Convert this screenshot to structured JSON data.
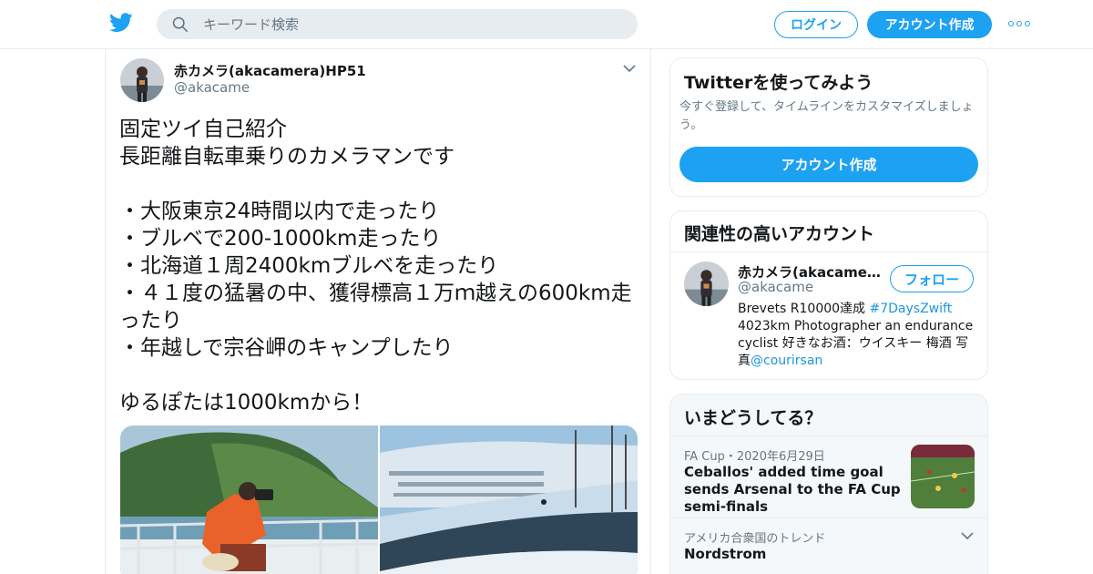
{
  "nav": {
    "search_placeholder": "キーワード検索",
    "login_label": "ログイン",
    "signup_label": "アカウント作成",
    "more_icon": "more-dots-icon",
    "brand_color": "#1da1f2"
  },
  "tweet": {
    "author_name": "赤カメラ(akacamera)HP51",
    "author_handle": "@akacame",
    "text": "固定ツイ自己紹介\n長距離自転車乗りのカメラマンです\n\n・大阪東京24時間以内で走ったり\n・ブルベで200-1000km走ったり\n・北海道１周2400kmブルベを走ったり\n・４１度の猛暑の中、獲得標高１万ｍ越えの600km走ったり\n・年越しで宗谷岬のキャンプしたり\n\nゆるぽたは1000kmから！",
    "media": [
      {
        "description_icon": "photo-cyclist-coast"
      },
      {
        "description_icon": "photo-snowy-road"
      }
    ]
  },
  "signup_card": {
    "title": "Twitterを使ってみよう",
    "subtitle": "今すぐ登録して、タイムラインをカスタマイズしましょう。",
    "cta": "アカウント作成"
  },
  "related_card": {
    "title": "関連性の高いアカウント",
    "account": {
      "name": "赤カメラ(akacamera)HP51",
      "handle": "@akacame",
      "follow_label": "フォロー",
      "bio_prefix": "Brevets R10000達成 ",
      "bio_hashtag": "#7DaysZwift",
      "bio_middle": " 4023km Photographer an endurance cyclist 好きなお酒：ウイスキー 梅酒 写真",
      "bio_mention": "@courirsan"
    }
  },
  "trends_card": {
    "title": "いまどうしてる？",
    "items": [
      {
        "meta": "FA Cup・2020年6月29日",
        "headline": "Ceballos' added time goal sends Arsenal to the FA Cup semi-finals"
      },
      {
        "meta": "アメリカ合衆国のトレンド",
        "name": "Nordstrom"
      }
    ]
  }
}
